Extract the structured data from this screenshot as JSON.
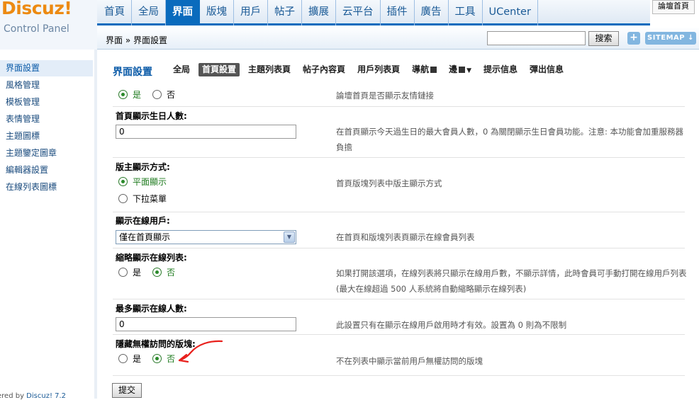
{
  "logo": {
    "brand": "Discuz!",
    "subtitle": "Control Panel"
  },
  "topnav": {
    "items": [
      "首頁",
      "全局",
      "界面",
      "版塊",
      "用戶",
      "帖子",
      "擴展",
      "云平台",
      "插件",
      "廣告",
      "工具",
      "UCenter"
    ],
    "active_index": 2,
    "forum_home": "論壇首頁"
  },
  "subbar": {
    "breadcrumb": "界面 » 界面設置",
    "search_value": "",
    "search_button": "搜索",
    "plus": "+",
    "sitemap": "SITEMAP ↓"
  },
  "sidebar": {
    "items": [
      "界面設置",
      "風格管理",
      "模板管理",
      "表情管理",
      "主題圖標",
      "主題鑒定圖章",
      "編輯器設置",
      "在線列表圖標"
    ],
    "active_index": 0,
    "powered_prefix": "ered by ",
    "powered_link": "Discuz! 7.2"
  },
  "main": {
    "title": "界面設置",
    "tabs": [
      "全局",
      "首頁設置",
      "主題列表頁",
      "帖子內容頁",
      "用戶列表頁",
      "導航",
      "邊",
      "提示信息",
      "彈出信息"
    ],
    "active_tab": 1,
    "settings": {
      "friendlinks": {
        "yes": "是",
        "no": "否",
        "selected": "yes",
        "desc": "論壇首頁是否顯示友情鏈接"
      },
      "birthday": {
        "label": "首頁顯示生日人數:",
        "value": "0",
        "desc": "在首頁顯示今天過生日的最大會員人數，0 為關閉顯示生日會員功能。注意: 本功能會加重服務器負擔"
      },
      "moderator_display": {
        "label": "版主顯示方式:",
        "option1": "平面顯示",
        "option2": "下拉菜單",
        "selected": "option1",
        "desc": "首頁版塊列表中版主顯示方式"
      },
      "online_users": {
        "label": "顯示在線用戶:",
        "value": "僅在首頁顯示",
        "desc": "在首頁和版塊列表頁顯示在線會員列表"
      },
      "online_collapse": {
        "label": "縮略顯示在線列表:",
        "yes": "是",
        "no": "否",
        "selected": "no",
        "desc": "如果打開該選項，在線列表將只顯示在線用戶數，不顯示詳情，此時會員可手動打開在線用戶列表(最大在線超過 500 人系統將自動縮略顯示在線列表)"
      },
      "max_online": {
        "label": "最多顯示在線人數:",
        "value": "0",
        "desc": "此設置只有在顯示在線用戶啟用時才有效。設置為 0 則為不限制"
      },
      "hide_forums": {
        "label": "隱藏無權訪問的版塊:",
        "yes": "是",
        "no": "否",
        "selected": "no",
        "desc": "不在列表中顯示當前用戶無權訪問的版塊"
      }
    },
    "submit": "提交"
  },
  "colors": {
    "brand_orange": "#ec8a12",
    "nav_active": "#0a6bbd",
    "link_blue": "#1a4b7e",
    "annotation_red": "#e8201c"
  }
}
